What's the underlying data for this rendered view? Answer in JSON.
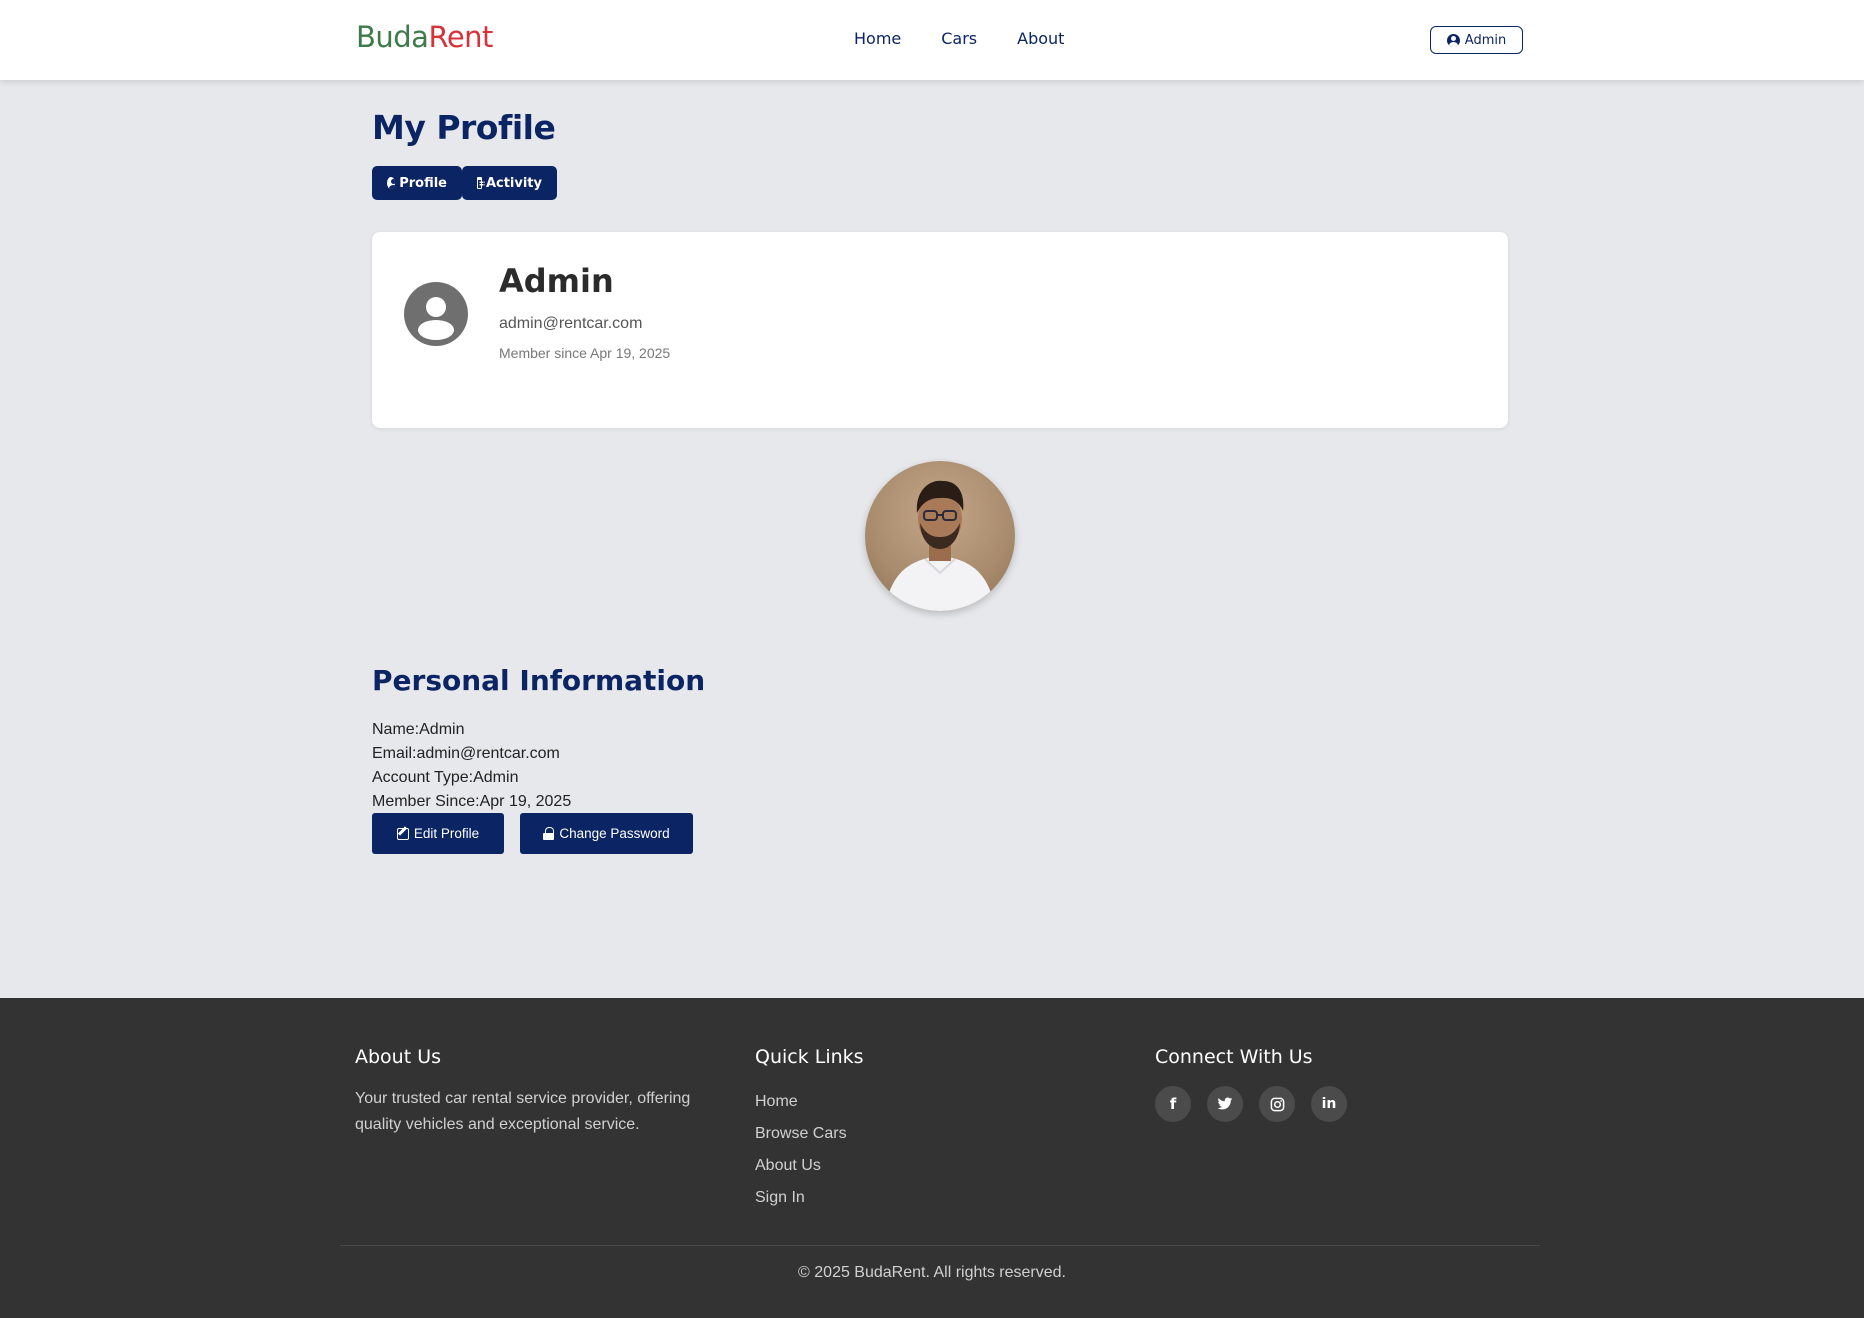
{
  "brand": {
    "part1": "Buda",
    "part2": "Rent",
    "color1": "#3f7a4a",
    "color2": "#d63339"
  },
  "nav": {
    "items": [
      {
        "label": "Home"
      },
      {
        "label": "Cars"
      },
      {
        "label": "About"
      }
    ],
    "user_button": {
      "label": "Admin",
      "icon": "user-circle-icon"
    }
  },
  "page": {
    "title": "My Profile",
    "tabs": [
      {
        "label": "Profile",
        "icon": "user-circle-icon"
      },
      {
        "label": "Activity",
        "icon": "calendar-icon"
      }
    ]
  },
  "profile_card": {
    "name": "Admin",
    "email": "admin@rentcar.com",
    "member_since": "Member since Apr 19, 2025"
  },
  "personal_info": {
    "title": "Personal Information",
    "rows": [
      {
        "label": "Name:",
        "value": "Admin"
      },
      {
        "label": "Email:",
        "value": "admin@rentcar.com"
      },
      {
        "label": "Account Type:",
        "value": "Admin"
      },
      {
        "label": "Member Since:",
        "value": "Apr 19, 2025"
      }
    ],
    "edit_label": "Edit Profile",
    "password_label": "Change Password"
  },
  "footer": {
    "about": {
      "title": "About Us",
      "text": "Your trusted car rental service provider, offering quality vehicles and exceptional service."
    },
    "quick_links": {
      "title": "Quick Links",
      "items": [
        {
          "label": "Home"
        },
        {
          "label": "Browse Cars"
        },
        {
          "label": "About Us"
        },
        {
          "label": "Sign In"
        }
      ]
    },
    "connect": {
      "title": "Connect With Us",
      "icons": [
        "facebook-icon",
        "twitter-icon",
        "instagram-icon",
        "linkedin-icon"
      ]
    },
    "copyright": "© 2025 BudaRent. All rights reserved."
  },
  "colors": {
    "primary": "#0b2463",
    "background": "#e7e8eb",
    "footer": "#333333"
  }
}
